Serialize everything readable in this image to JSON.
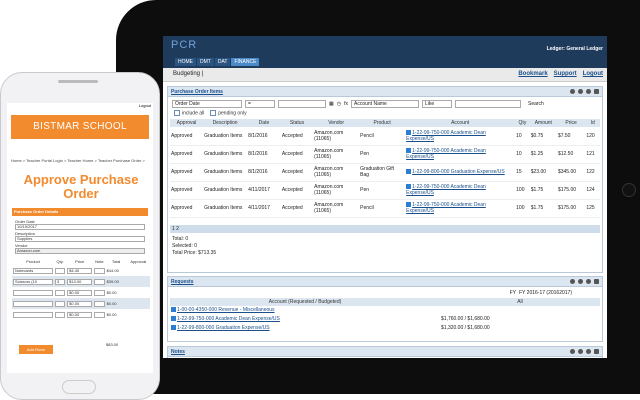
{
  "tablet": {
    "logo": "PCR",
    "ledger": "Ledger: General Ledger",
    "nav": [
      "HOME",
      "DMT",
      "DAT",
      "FINANCE"
    ],
    "budgeting": "Budgeting |",
    "links": {
      "bookmark": "Bookmark",
      "support": "Support",
      "logout": "Logout"
    },
    "po_panel": {
      "title": "Purchase Order Items",
      "filter": {
        "field": "Order Date",
        "op": "=",
        "field2": "Account Name",
        "op2": "Like",
        "search": "Search"
      },
      "include_all": "include all",
      "pending_only": "pending only",
      "columns": [
        "Approval",
        "Description",
        "Date",
        "Status",
        "Vendor",
        "Product",
        "Account",
        "Qty",
        "Amount",
        "Price",
        "Id"
      ],
      "rows": [
        {
          "approval": "Approved",
          "description": "Graduation Items",
          "date": "8/1/2016",
          "status": "Accepted",
          "vendor": "Amazon.com (11065)",
          "product": "Pencil",
          "account": "1-22-99-750-000 Academic Dean Expense/US",
          "qty": "10",
          "amount": "$0.75",
          "price": "$7.50",
          "id": "120"
        },
        {
          "approval": "Approved",
          "description": "Graduation Items",
          "date": "8/1/2016",
          "status": "Accepted",
          "vendor": "Amazon.com (11065)",
          "product": "Pen",
          "account": "1-22-99-750-000 Academic Dean Expense/US",
          "qty": "10",
          "amount": "$1.25",
          "price": "$12.50",
          "id": "121"
        },
        {
          "approval": "Approved",
          "description": "Graduation Items",
          "date": "8/1/2016",
          "status": "Accepted",
          "vendor": "Amazon.com (11065)",
          "product": "Graduation Gift Bag",
          "account": "1-22-99-800-000 Graduation Expense/US",
          "qty": "15",
          "amount": "$23.00",
          "price": "$345.00",
          "id": "122"
        },
        {
          "approval": "Approved",
          "description": "Graduation Items",
          "date": "4/11/2017",
          "status": "Accepted",
          "vendor": "Amazon.com (11065)",
          "product": "Pen",
          "account": "1-22-99-750-000 Academic Dean Expense/US",
          "qty": "100",
          "amount": "$1.75",
          "price": "$175.00",
          "id": "124"
        },
        {
          "approval": "Approved",
          "description": "Graduation Items",
          "date": "4/11/2017",
          "status": "Accepted",
          "vendor": "Amazon.com (11065)",
          "product": "Pencil",
          "account": "1-22-99-750-000 Academic Dean Expense/US",
          "qty": "100",
          "amount": "$1.75",
          "price": "$175.00",
          "id": "125"
        }
      ],
      "pager": "1 2",
      "totals": {
        "total": "Total: 0",
        "selected": "Selected: 0",
        "total_price": "Total Price: $713.35"
      }
    },
    "req_panel": {
      "title": "Requests",
      "fy_label": "FY",
      "fy_value": "FY 2016-17 (20162017)",
      "columns": [
        "Account (Requested / Budgeted)",
        "All"
      ],
      "rows": [
        {
          "account": "1-00-00-4350-000 Revenue - Miscellaneous",
          "value": ""
        },
        {
          "account": "1-22-99-750-000 Academic Dean Expense/US",
          "value": "$1,760.00 / $1,680.00"
        },
        {
          "account": "1-22-99-800-000 Graduation Expense/US",
          "value": "$1,320.00 / $1,680.00"
        }
      ]
    },
    "notes_panel": {
      "title": "Notes"
    }
  },
  "phone": {
    "logout": "Logout",
    "school": "BISTMAR SCHOOL",
    "breadcrumb": "Home > Teacher Portal Login > Teacher Home > Teacher Purchase Order >",
    "title": "Approve Purchase Order",
    "section": "Purchase Order Details",
    "order_date_label": "Order Date",
    "order_date": "10/19/2017",
    "description_label": "Description",
    "description": "Supplies",
    "vendor_label": "Vendor",
    "vendor": "Amazon.com",
    "columns": [
      "Product",
      "Qty.",
      "Price",
      "Note",
      "Total",
      "Approval"
    ],
    "items": [
      {
        "product": "Notecards",
        "qty": "",
        "price": "$4.40",
        "total": "$44.00"
      },
      {
        "product": "Scissors (10",
        "qty": "3",
        "price": "$13.00",
        "total": "$39.00"
      },
      {
        "product": "",
        "qty": "",
        "price": "$0.00",
        "total": "$0.00"
      },
      {
        "product": "",
        "qty": "",
        "price": "$0.00",
        "total": "$0.00"
      },
      {
        "product": "",
        "qty": "",
        "price": "$0.00",
        "total": "$0.00"
      }
    ],
    "add_rows": "Add Rows",
    "grand_total": "$83.00"
  }
}
